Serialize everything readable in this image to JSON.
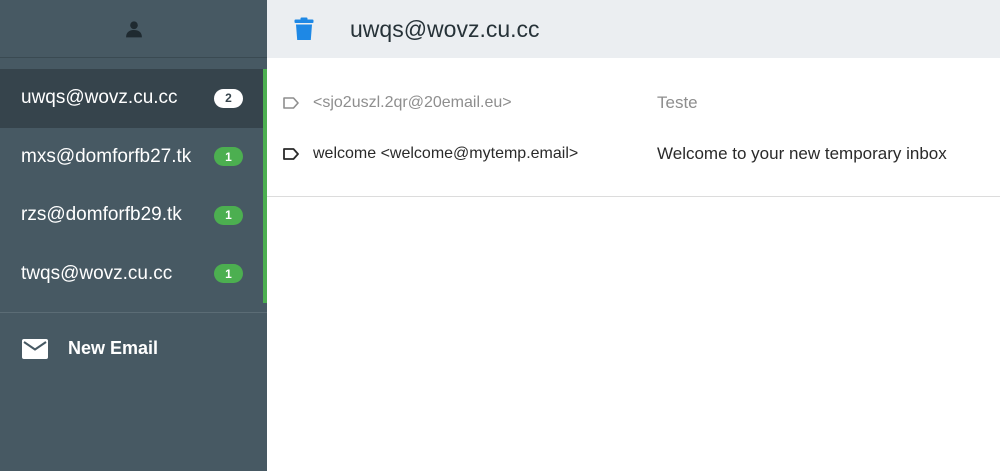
{
  "sidebar": {
    "account_icon": "person-icon",
    "inboxes": [
      {
        "address": "uwqs@wovz.cu.cc",
        "count": "2",
        "active": true
      },
      {
        "address": "mxs@domforfb27.tk",
        "count": "1",
        "active": false
      },
      {
        "address": "rzs@domforfb29.tk",
        "count": "1",
        "active": false
      },
      {
        "address": "twqs@wovz.cu.cc",
        "count": "1",
        "active": false
      }
    ],
    "new_email_label": "New Email",
    "new_email_icon": "envelope-icon"
  },
  "header": {
    "delete_icon": "trash-icon",
    "title": "uwqs@wovz.cu.cc"
  },
  "messages": [
    {
      "from": "<sjo2uszl.2qr@20email.eu>",
      "subject": "Teste",
      "read": true
    },
    {
      "from": "welcome <welcome@mytemp.email>",
      "subject": "Welcome to your new temporary inbox",
      "read": false
    }
  ],
  "colors": {
    "sidebar_bg": "#475963",
    "active_item_bg": "#36444c",
    "accent_green": "#4caf50",
    "trash_blue": "#1e88e5",
    "topbar_bg": "#ebeef1"
  }
}
